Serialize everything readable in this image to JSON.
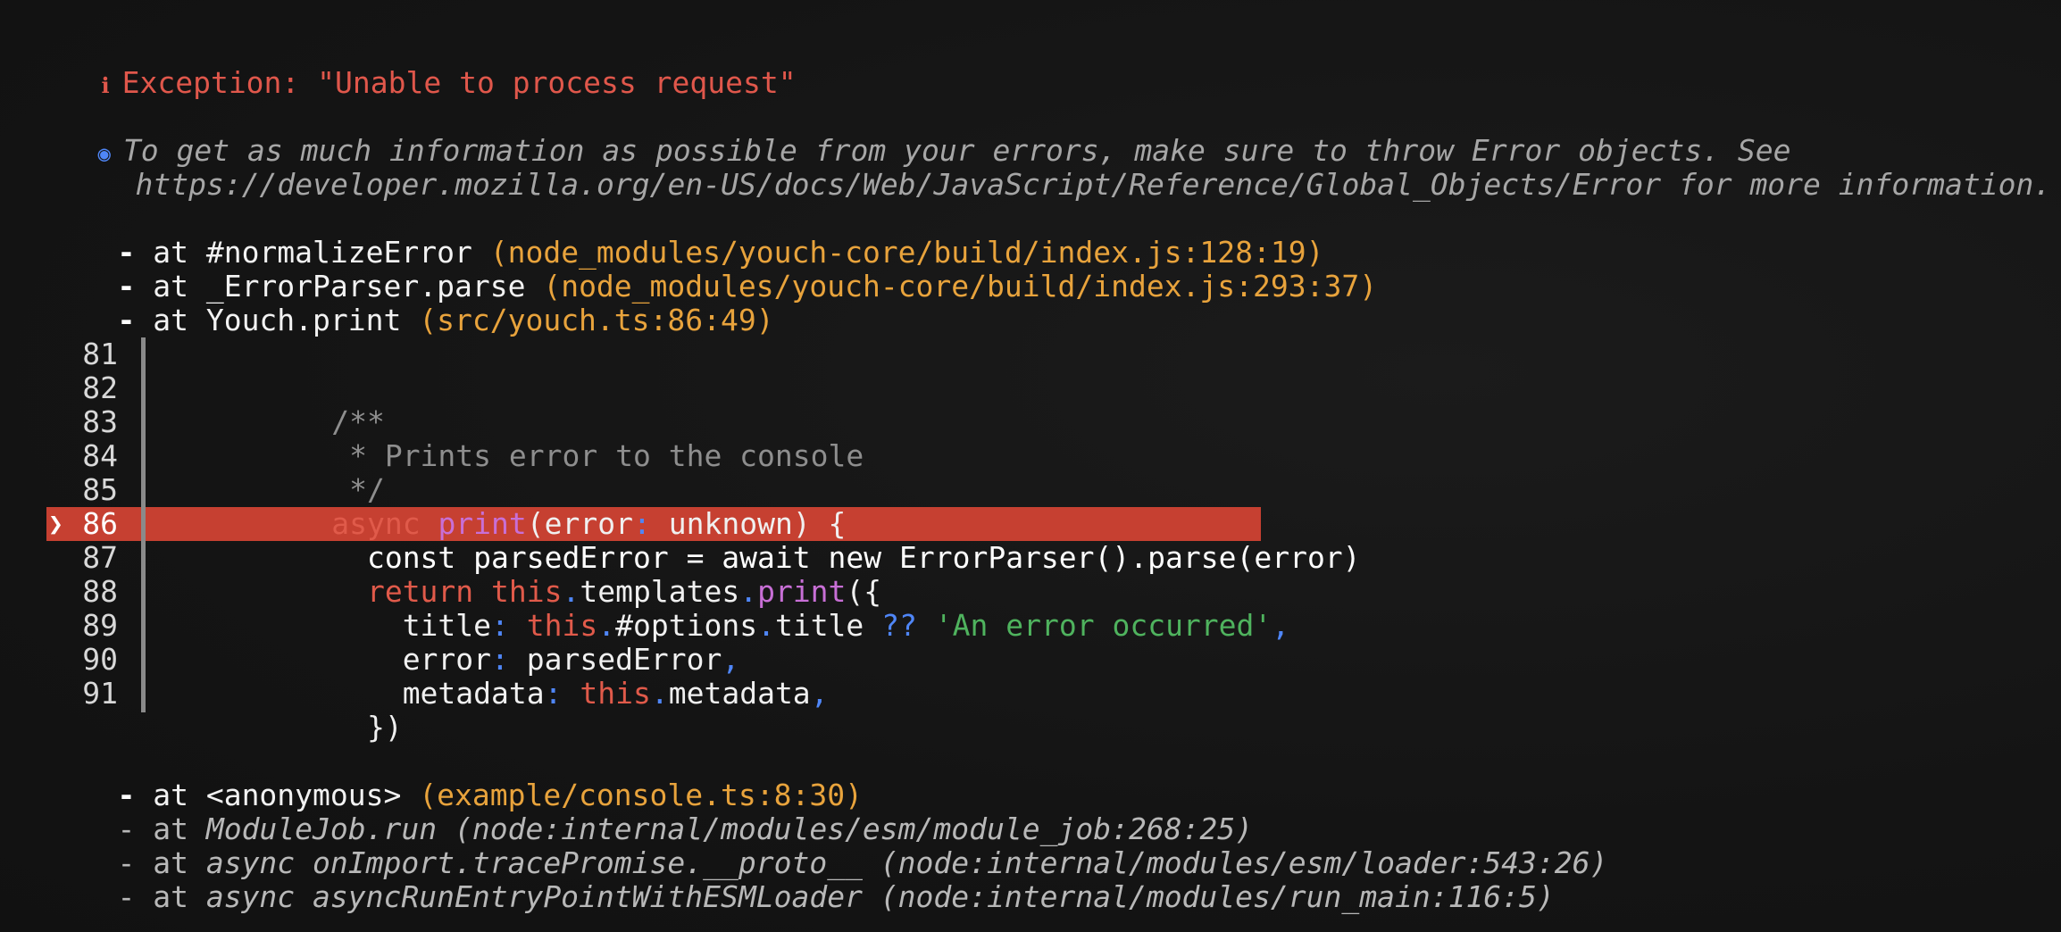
{
  "exception": {
    "icon": "ℹ",
    "text": "Exception: \"Unable to process request\""
  },
  "hint": {
    "icon": "◉",
    "line1": "To get as much information as possible from your errors, make sure to throw Error objects. See",
    "line2": "https://developer.mozilla.org/en-US/docs/Web/JavaScript/Reference/Global_Objects/Error for more information."
  },
  "stack_top": [
    {
      "dash": "-",
      "at": " at #normalizeError ",
      "loc": "(node_modules/youch-core/build/index.js:128:19)"
    },
    {
      "dash": "-",
      "at": " at _ErrorParser.parse ",
      "loc": "(node_modules/youch-core/build/index.js:293:37)"
    },
    {
      "dash": "-",
      "at": " at Youch.print ",
      "loc": "(src/youch.ts:86:49)"
    }
  ],
  "code_frame": {
    "pointer": "❯",
    "line_numbers": [
      "81",
      "82",
      "83",
      "84",
      "85",
      "86",
      "87",
      "88",
      "89",
      "90",
      "91"
    ],
    "lines": {
      "l82": "/**",
      "l83": " * Prints error to the console",
      "l84": " */",
      "l85_kw": "async ",
      "l85_fn": "print",
      "l85_a": "(error",
      "l85_p": ":",
      "l85_b": " unknown) {",
      "l86": "  const parsedError = await new ErrorParser().parse(error)",
      "l87_kw": "  return ",
      "l87_this": "this",
      "l87_d1": ".",
      "l87_a": "templates",
      "l87_d2": ".",
      "l87_fn": "print",
      "l87_b": "({",
      "l88_a": "    title",
      "l88_p": ":",
      "l88_this": " this",
      "l88_d1": ".",
      "l88_b": "#options",
      "l88_d2": ".",
      "l88_c": "title ",
      "l88_op": "??",
      "l88_str": " 'An error occurred'",
      "l88_comma": ",",
      "l89_a": "    error",
      "l89_p": ":",
      "l89_b": " parsedError",
      "l89_comma": ",",
      "l90_a": "    metadata",
      "l90_p": ":",
      "l90_this": " this",
      "l90_d": ".",
      "l90_b": "metadata",
      "l90_comma": ",",
      "l91": "  })"
    }
  },
  "stack_bottom": {
    "anon": {
      "dash": "-",
      "at": " at <anonymous> ",
      "loc": "(example/console.ts:8:30)"
    },
    "internal": [
      {
        "prefix": "- at ",
        "fn": "ModuleJob.run",
        "loc": " (node:internal/modules/esm/module_job:268:25)"
      },
      {
        "prefix": "- at ",
        "fn": "async onImport.tracePromise.__proto__",
        "loc": " (node:internal/modules/esm/loader:543:26)"
      },
      {
        "prefix": "- at ",
        "fn": "async asyncRunEntryPointWithESMLoader",
        "loc": " (node:internal/modules/run_main:116:5)"
      }
    ]
  },
  "colors": {
    "background": "#141414",
    "error_red": "#e0574b",
    "highlight_red": "#c64031",
    "location_orange": "#e8a33c",
    "info_blue": "#4f86f7",
    "string_green": "#4fb35e",
    "function_purple": "#c86fd6"
  }
}
